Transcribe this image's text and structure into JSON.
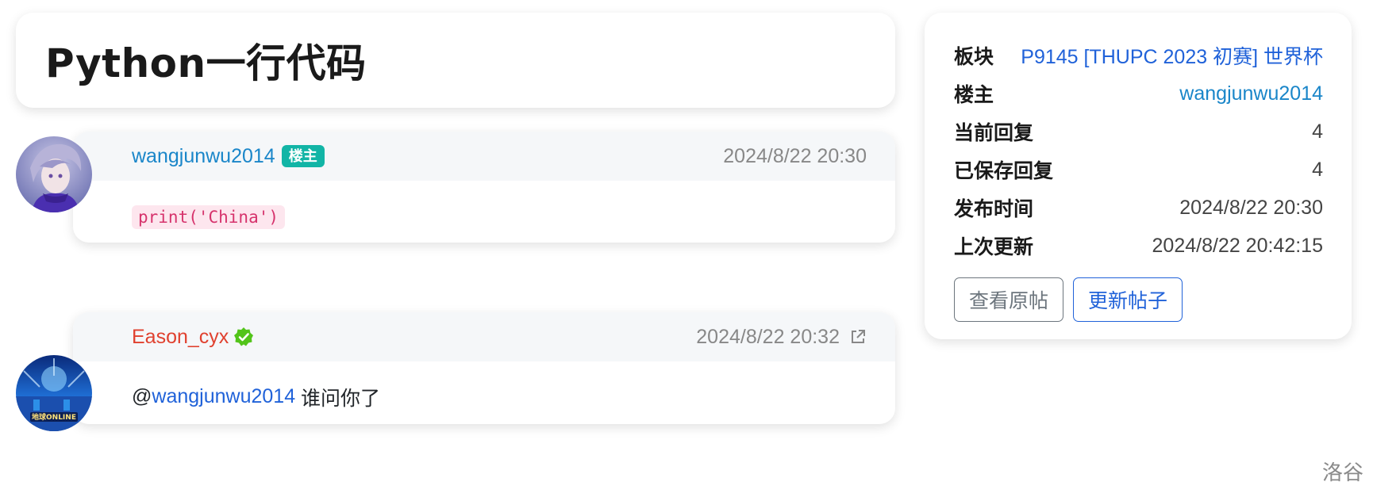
{
  "title": "Python一行代码",
  "replies": [
    {
      "username": "wangjunwu2014",
      "badge": "楼主",
      "time": "2024/8/22 20:30",
      "code": "print('China')"
    },
    {
      "username": "Eason_cyx",
      "time": "2024/8/22 20:32",
      "at": "@",
      "mention": "wangjunwu2014",
      "text": " 谁问你了"
    }
  ],
  "info": {
    "rows": [
      {
        "key": "板块",
        "value": "P9145 [THUPC 2023 初赛] 世界杯"
      },
      {
        "key": "楼主",
        "value": "wangjunwu2014"
      },
      {
        "key": "当前回复",
        "value": "4"
      },
      {
        "key": "已保存回复",
        "value": "4"
      },
      {
        "key": "发布时间",
        "value": "2024/8/22 20:30"
      },
      {
        "key": "上次更新",
        "value": "2024/8/22 20:42:15"
      }
    ],
    "view_original": "查看原帖",
    "update_post": "更新帖子"
  },
  "footer": "洛谷",
  "colors": {
    "link": "#2062d9",
    "username_blue": "#1a86c9",
    "username_red": "#e0412f",
    "badge_bg": "#12b5a6",
    "verified_green": "#52c41a"
  },
  "icons": [
    "verified-icon",
    "external-link-icon"
  ]
}
